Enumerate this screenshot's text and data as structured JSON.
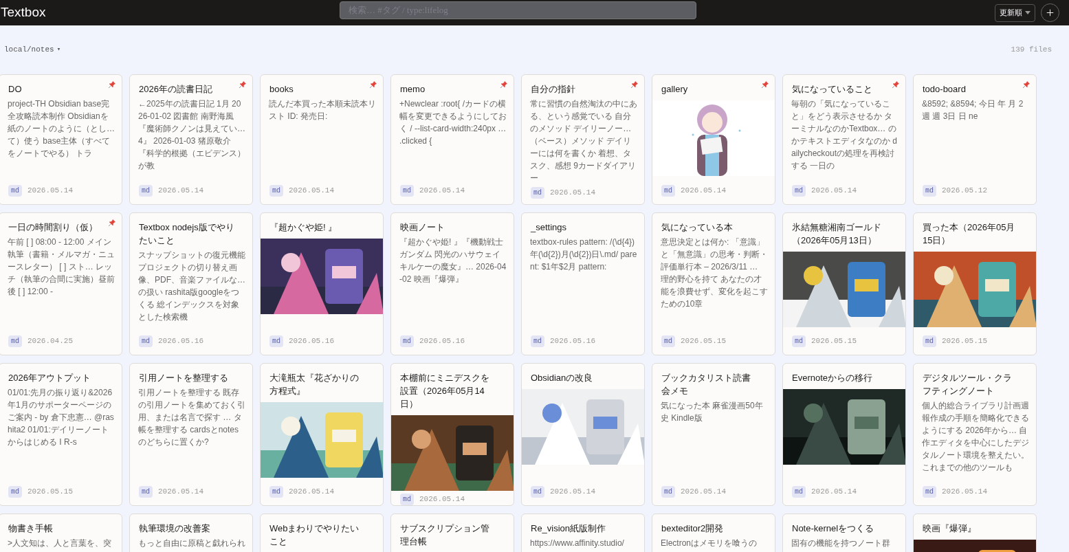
{
  "header": {
    "title": "Textbox",
    "search": {
      "placeholder": "検索… #タグ / type:lifelog"
    },
    "sort": {
      "label": "更新順"
    }
  },
  "location": {
    "path": "local/notes",
    "caret": "▾",
    "file_count": "139 files"
  },
  "cards": [
    {
      "title": "DO",
      "kind": "text",
      "preview": "project-TH Obsidian base完全攻略読本制作 Obsidianを紙のノートのように（とし… て）使う base主体（すべてをノートでやる） トラ",
      "pinned": true,
      "type": "md",
      "date": "2026.05.14"
    },
    {
      "title": "2026年の読書日記",
      "kind": "text",
      "preview": "←2025年の読書日記 1月 2026-01-02 図書館 南野海風『魔術師クノンは見えてい… 4』 2026-01-03 猪原敬介『科学的根拠（エビデンス）が教",
      "pinned": true,
      "type": "md",
      "date": "2026.05.14"
    },
    {
      "title": "books",
      "kind": "text",
      "preview": "読んだ本買った本順未読本リスト ID: 発売日:",
      "pinned": true,
      "type": "md",
      "date": "2026.05.14"
    },
    {
      "title": "memo",
      "kind": "text",
      "preview": "+Newclear :root{ /カードの横幅を変更できるようにしておく / --list-card-width:240px … .clicked {",
      "pinned": true,
      "type": "md",
      "date": "2026.05.14"
    },
    {
      "title": "自分の指針",
      "kind": "text",
      "preview": "常に習慣の自然淘汰の中にある、という感覚でいる 自分のメソッド デイリーノー… （ベース）メソッド デイリーには何を書くか 着想、タスク、感想 9カードダイアリー",
      "pinned": true,
      "type": "md",
      "date": "2026.05.14"
    },
    {
      "title": "gallery",
      "kind": "picture",
      "pinned": true,
      "type": "md",
      "date": "2026.05.14"
    },
    {
      "title": "気になっていること",
      "kind": "text",
      "preview": "毎朝の「気になっていること」をどう表示させるか ターミナルなのかTextbox… のかテキストエディタなのか dailycheckoutの処理を再検討する 一日の",
      "pinned": true,
      "type": "md",
      "date": "2026.05.14"
    },
    {
      "title": "todo-board",
      "kind": "text",
      "preview": "&8592; &8594; 今日 年 月 2週 週 3日 日 ne",
      "pinned": true,
      "type": "md",
      "date": "2026.05.12"
    },
    {
      "title": "一日の時間割り（仮）",
      "kind": "text",
      "preview": "午前 [ ] 08:00 - 12:00 メイン執筆（書籍・メルマガ・ニュースレター） [ ] スト… レッチ（執筆の合間に実施）昼前後 [ ] 12:00 -",
      "pinned": true,
      "type": "md",
      "date": "2026.04.25"
    },
    {
      "title": "Textbox nodejs版でやりたいこと",
      "kind": "text",
      "preview": "スナップショットの復元機能プロジェクトの切り替え画像、PDF、音楽ファイルな… の扱い rashita版googleをつくる 総インデックスを対象とした検索機",
      "pinned": false,
      "type": "md",
      "date": "2026.05.16"
    },
    {
      "title": "『超かぐや姫! 』",
      "kind": "picture",
      "pinned": false,
      "type": "md",
      "date": "2026.05.16"
    },
    {
      "title": "映画ノート",
      "kind": "text",
      "preview": "『超かぐや姫! 』『機動戦士ガンダム 閃光のハサウェイキルケーの魔女』… 2026-04-02 映画『爆弾』",
      "pinned": false,
      "type": "md",
      "date": "2026.05.16"
    },
    {
      "title": "_settings",
      "kind": "text",
      "preview": "textbox-rules pattern: /(\\d{4})年(\\d{2})月(\\d{2})日\\.md/ parent: $1年$2月 pattern:",
      "pinned": false,
      "type": "md",
      "date": "2026.05.16"
    },
    {
      "title": "気になっている本",
      "kind": "text",
      "preview": "意思決定とは何か: 「意識」と「無意識」の思考・判断・評価単行本 – 2026/3/11 … 理的野心を持て あなたの才能を浪費せず、変化を起こすための10章",
      "pinned": false,
      "type": "md",
      "date": "2026.05.15"
    },
    {
      "title": "氷結無糖湘南ゴールド（2026年05月13日）",
      "kind": "picture",
      "pinned": false,
      "type": "md",
      "date": "2026.05.15"
    },
    {
      "title": "買った本（2026年05月15日）",
      "kind": "picture",
      "pinned": false,
      "type": "md",
      "date": "2026.05.15"
    },
    {
      "title": "2026年アウトプット",
      "kind": "text",
      "preview": "01/01:先月の振り返り&2026年1月のサポーターページのご案内 - by 倉下忠憲… @rashita2 01/01:デイリーノートからはじめる I R-s",
      "pinned": false,
      "type": "md",
      "date": "2026.05.15"
    },
    {
      "title": "引用ノートを整理する",
      "kind": "text",
      "preview": "引用ノートを整理する 既存の引用ノートを集めておく引用、または名言で探す … タ帳を整理する cardsとnotesのどちらに置くか?",
      "pinned": false,
      "type": "md",
      "date": "2026.05.14"
    },
    {
      "title": "大滝瓶太『花ざかりの方程式』",
      "kind": "picture",
      "pinned": false,
      "type": "md",
      "date": "2026.05.14"
    },
    {
      "title": "本棚前にミニデスクを設置（2026年05月14日）",
      "kind": "picture",
      "pinned": false,
      "type": "md",
      "date": "2026.05.14"
    },
    {
      "title": "Obsidianの改良",
      "kind": "picture",
      "pinned": false,
      "type": "md",
      "date": "2026.05.14"
    },
    {
      "title": "ブックカタリスト読書会メモ",
      "kind": "text",
      "preview": "気になった本 麻雀漫画50年史 Kindle版",
      "pinned": false,
      "type": "md",
      "date": "2026.05.14"
    },
    {
      "title": "Evernoteからの移行",
      "kind": "picture",
      "pinned": false,
      "type": "md",
      "date": "2026.05.14"
    },
    {
      "title": "デジタルツール・クラフティングノート",
      "kind": "text",
      "preview": "個人的総合ライブラリ計画週報作成の手順を簡略化できるようにする 2026年から… 自作エディタを中心にしたデジタルノート環境を整えたい。これまでの他のツールも",
      "pinned": false,
      "type": "md",
      "date": "2026.05.14"
    },
    {
      "title": "物書き手帳",
      "kind": "text",
      "preview": ">人文知は、人と言葉を、突",
      "pinned": false
    },
    {
      "title": "執筆環境の改善案",
      "kind": "text",
      "preview": "もっと自由に原稿と戯れられ",
      "pinned": false
    },
    {
      "title": "Webまわりでやりたいこと",
      "kind": "text",
      "pinned": false
    },
    {
      "title": "サブスクリプション管理台帳",
      "kind": "text",
      "pinned": false
    },
    {
      "title": "Re_vision紙版制作",
      "kind": "text",
      "preview": "https://www.affinity.studio/",
      "pinned": false
    },
    {
      "title": "bexteditor2開発",
      "kind": "text",
      "preview": "Electronはメモリを喰うの",
      "pinned": false
    },
    {
      "title": "Note-kernelをつくる",
      "kind": "text",
      "preview": "固有の機能を持つノート群",
      "pinned": false
    },
    {
      "title": "映画『爆弾』",
      "kind": "picture",
      "pinned": false
    }
  ]
}
